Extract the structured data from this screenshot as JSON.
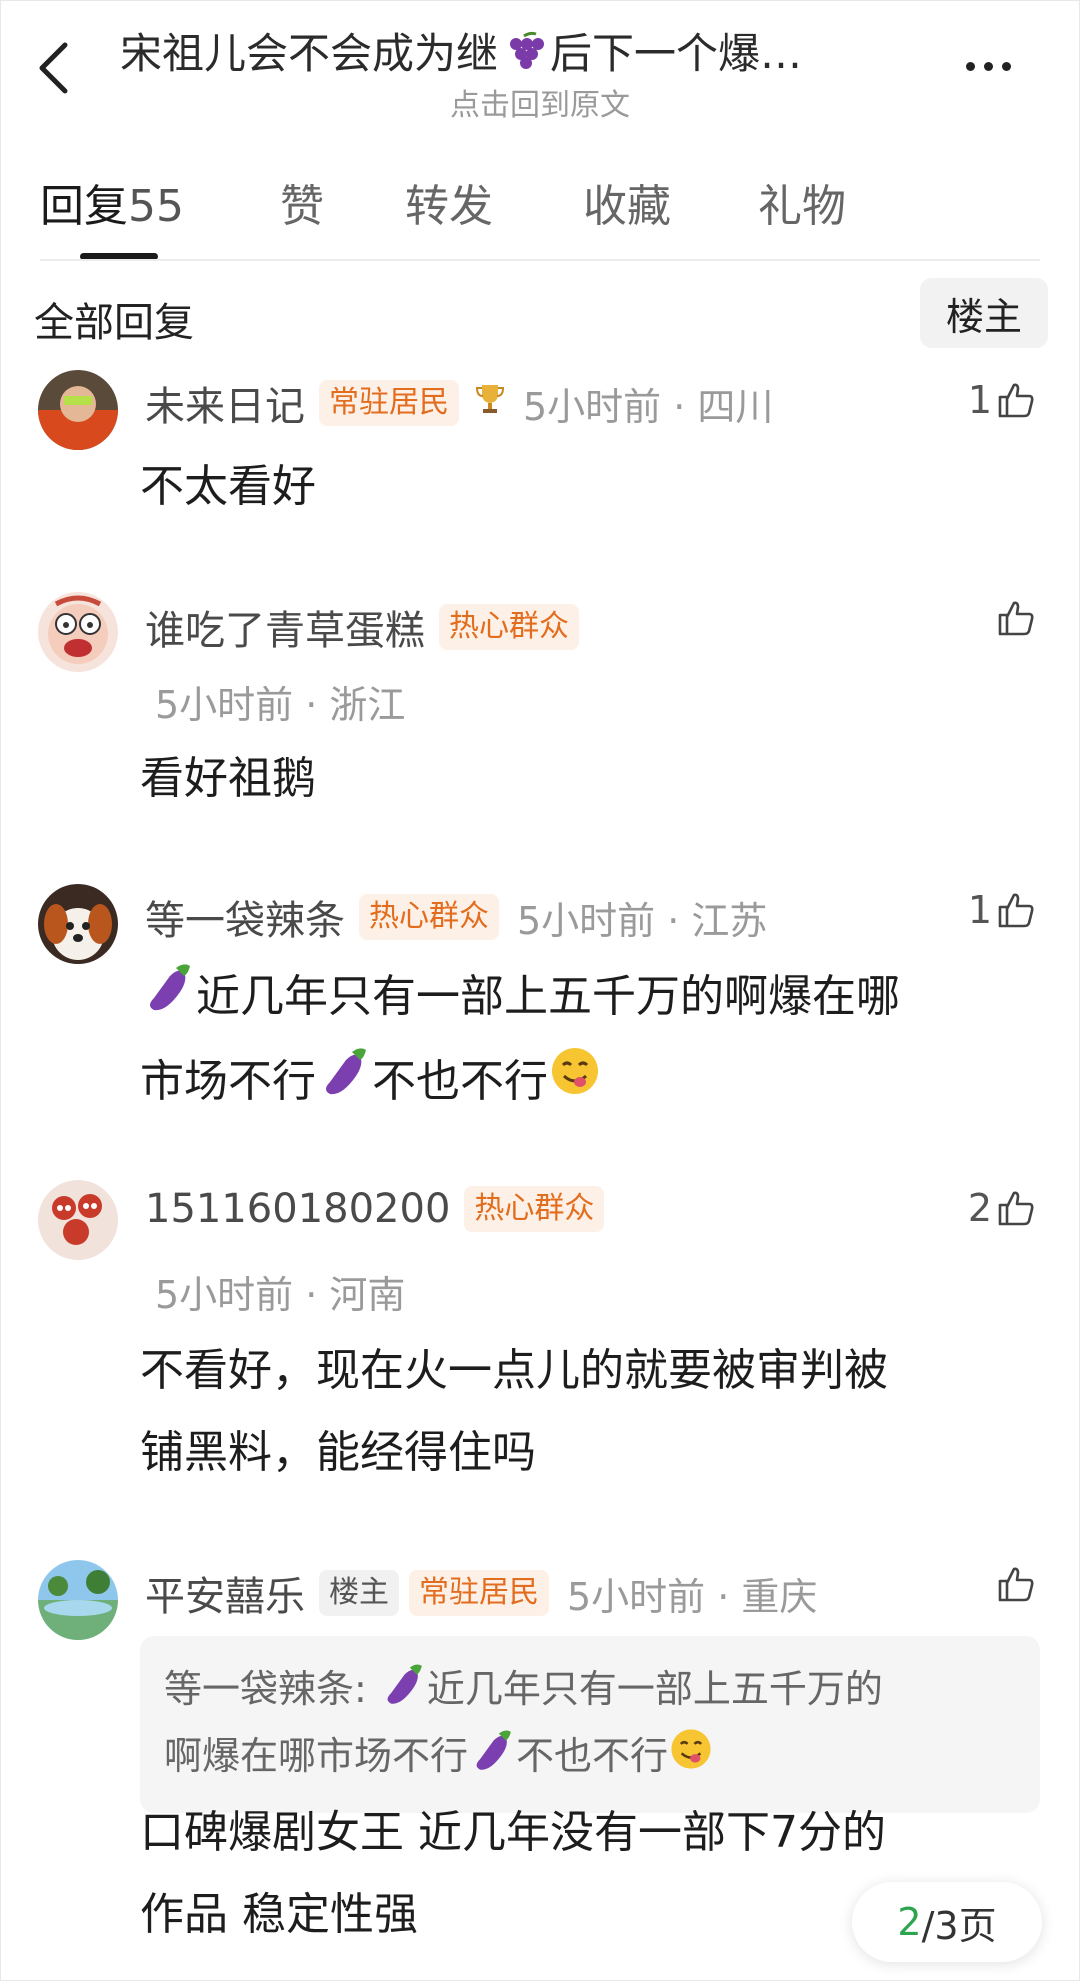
{
  "header": {
    "title_part1": "宋祖儿会不会成为继",
    "title_part2": "后下一个爆…",
    "title_emoji": "grape-emoji",
    "subtitle": "点击回到原文"
  },
  "tabs": [
    {
      "label": "回复",
      "count": "55"
    },
    {
      "label": "赞"
    },
    {
      "label": "转发"
    },
    {
      "label": "收藏"
    },
    {
      "label": "礼物"
    }
  ],
  "section_title": "全部回复",
  "filter_label": "楼主",
  "comments": [
    {
      "name": "未来日记",
      "badge": "常驻居民",
      "time_location": "5小时前 · 四川",
      "likes": "1",
      "text": "不太看好"
    },
    {
      "name": "谁吃了青草蛋糕",
      "badge": "热心群众",
      "time_location": "5小时前 · 浙江",
      "likes": "",
      "text": "看好祖鹅"
    },
    {
      "name": "等一袋辣条",
      "badge": "热心群众",
      "time_location": "5小时前 · 江苏",
      "likes": "1",
      "text_line1": "近几年只有一部上五千万的啊爆在哪",
      "text_line2a": "市场不行",
      "text_line2b": "不也不行"
    },
    {
      "name": "151160180200",
      "badge": "热心群众",
      "time_location": "5小时前 · 河南",
      "likes": "2",
      "text_line1": "不看好，现在火一点儿的就要被审判被",
      "text_line2": "铺黑料，能经得住吗"
    },
    {
      "name": "平安囍乐",
      "op_badge": "楼主",
      "badge": "常驻居民",
      "time_location": "5小时前 · 重庆",
      "likes": "",
      "quote_line1": "等一袋辣条: ",
      "quote_line1b": "近几年只有一部上五千万的",
      "quote_line2a": "啊爆在哪市场不行",
      "quote_line2b": "不也不行",
      "text_line1": "口碑爆剧女王 近几年没有一部下7分的",
      "text_line2": "作品 稳定性强"
    }
  ],
  "pager": {
    "current": "2",
    "total_label": "/3页"
  },
  "colors": {
    "badge_orange": "#e36d1e",
    "pager_current": "#2da44e"
  }
}
